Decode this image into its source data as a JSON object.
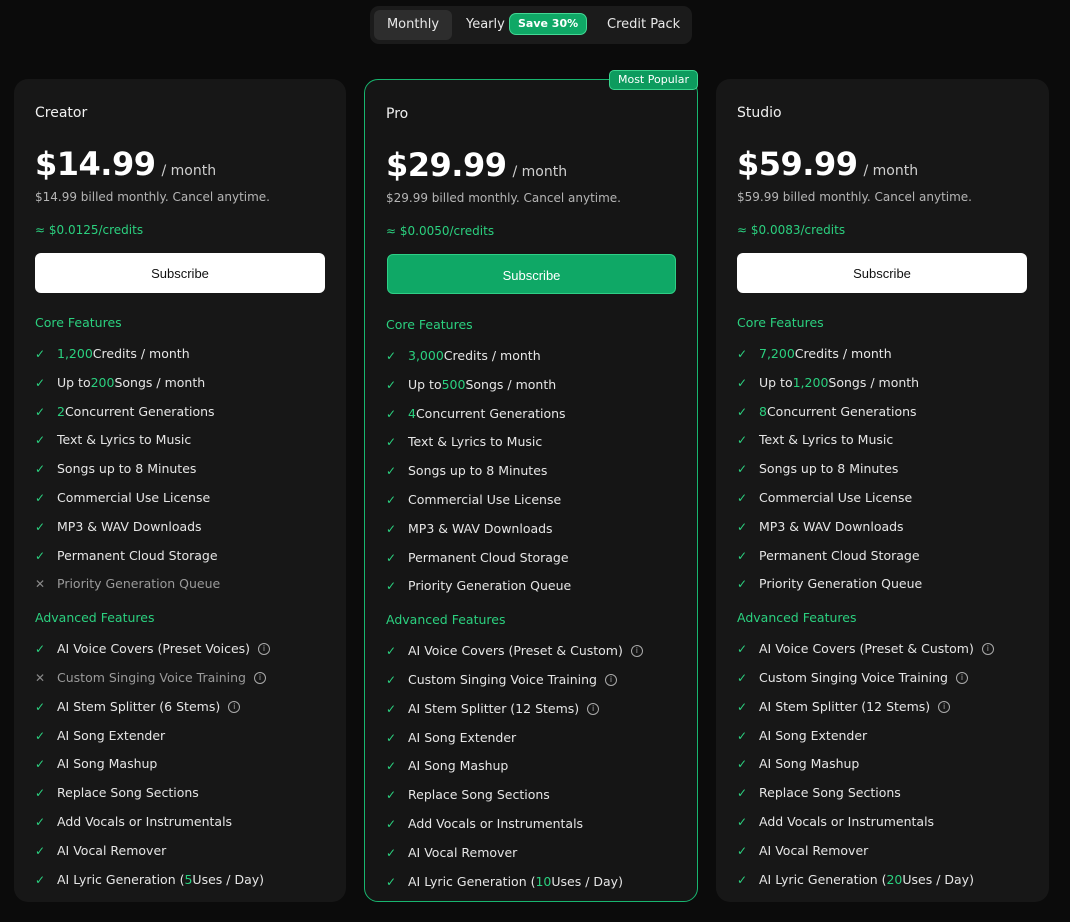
{
  "billing_toggle": {
    "monthly": "Monthly",
    "yearly": "Yearly",
    "save_badge": "Save 30%",
    "credit_pack": "Credit Pack"
  },
  "sections": {
    "core": "Core Features",
    "advanced": "Advanced Features"
  },
  "icons": {
    "included": "check-icon",
    "excluded": "x-icon",
    "info": "info-icon"
  },
  "colors": {
    "accent": "#2bd07f",
    "button_green": "#0fa866"
  },
  "plans": [
    {
      "name": "Creator",
      "price": "$14.99",
      "period": "/ month",
      "billed": "$14.99 billed monthly. Cancel anytime.",
      "credit_rate": "≈ $0.0125/credits",
      "subscribe_label": "Subscribe",
      "core": [
        {
          "included": true,
          "hl": "1,200",
          "text": " Credits / month"
        },
        {
          "included": true,
          "pre": "Up to ",
          "hl": "200",
          "text": " Songs / month"
        },
        {
          "included": true,
          "hl": "2",
          "text": " Concurrent Generations"
        },
        {
          "included": true,
          "text": "Text & Lyrics to Music"
        },
        {
          "included": true,
          "text": "Songs up to 8 Minutes"
        },
        {
          "included": true,
          "text": "Commercial Use License"
        },
        {
          "included": true,
          "text": "MP3 & WAV Downloads"
        },
        {
          "included": true,
          "text": "Permanent Cloud Storage"
        },
        {
          "included": false,
          "text": "Priority Generation Queue"
        }
      ],
      "advanced": [
        {
          "included": true,
          "text": "AI Voice Covers (Preset Voices)",
          "info": true
        },
        {
          "included": false,
          "text": "Custom Singing Voice Training",
          "info": true
        },
        {
          "included": true,
          "text": "AI Stem Splitter (6 Stems)",
          "info": true
        },
        {
          "included": true,
          "text": "AI Song Extender"
        },
        {
          "included": true,
          "text": "AI Song Mashup"
        },
        {
          "included": true,
          "text": "Replace Song Sections"
        },
        {
          "included": true,
          "text": "Add Vocals or Instrumentals"
        },
        {
          "included": true,
          "text": "AI Vocal Remover"
        },
        {
          "included": true,
          "pre": "AI Lyric Generation (",
          "hl": "5",
          "text": " Uses / Day)"
        }
      ]
    },
    {
      "name": "Pro",
      "badge": "Most Popular",
      "price": "$29.99",
      "period": "/ month",
      "billed": "$29.99 billed monthly. Cancel anytime.",
      "credit_rate": "≈ $0.0050/credits",
      "subscribe_label": "Subscribe",
      "core": [
        {
          "included": true,
          "hl": "3,000",
          "text": " Credits / month"
        },
        {
          "included": true,
          "pre": "Up to ",
          "hl": "500",
          "text": " Songs / month"
        },
        {
          "included": true,
          "hl": "4",
          "text": " Concurrent Generations"
        },
        {
          "included": true,
          "text": "Text & Lyrics to Music"
        },
        {
          "included": true,
          "text": "Songs up to 8 Minutes"
        },
        {
          "included": true,
          "text": "Commercial Use License"
        },
        {
          "included": true,
          "text": "MP3 & WAV Downloads"
        },
        {
          "included": true,
          "text": "Permanent Cloud Storage"
        },
        {
          "included": true,
          "text": "Priority Generation Queue"
        }
      ],
      "advanced": [
        {
          "included": true,
          "text": "AI Voice Covers (Preset & Custom)",
          "info": true
        },
        {
          "included": true,
          "text": "Custom Singing Voice Training",
          "info": true
        },
        {
          "included": true,
          "text": "AI Stem Splitter (12 Stems)",
          "info": true
        },
        {
          "included": true,
          "text": "AI Song Extender"
        },
        {
          "included": true,
          "text": "AI Song Mashup"
        },
        {
          "included": true,
          "text": "Replace Song Sections"
        },
        {
          "included": true,
          "text": "Add Vocals or Instrumentals"
        },
        {
          "included": true,
          "text": "AI Vocal Remover"
        },
        {
          "included": true,
          "pre": "AI Lyric Generation (",
          "hl": "10",
          "text": " Uses / Day)"
        }
      ]
    },
    {
      "name": "Studio",
      "price": "$59.99",
      "period": "/ month",
      "billed": "$59.99 billed monthly. Cancel anytime.",
      "credit_rate": "≈ $0.0083/credits",
      "subscribe_label": "Subscribe",
      "core": [
        {
          "included": true,
          "hl": "7,200",
          "text": " Credits / month"
        },
        {
          "included": true,
          "pre": "Up to ",
          "hl": "1,200",
          "text": " Songs / month"
        },
        {
          "included": true,
          "hl": "8",
          "text": " Concurrent Generations"
        },
        {
          "included": true,
          "text": "Text & Lyrics to Music"
        },
        {
          "included": true,
          "text": "Songs up to 8 Minutes"
        },
        {
          "included": true,
          "text": "Commercial Use License"
        },
        {
          "included": true,
          "text": "MP3 & WAV Downloads"
        },
        {
          "included": true,
          "text": "Permanent Cloud Storage"
        },
        {
          "included": true,
          "text": "Priority Generation Queue"
        }
      ],
      "advanced": [
        {
          "included": true,
          "text": "AI Voice Covers (Preset & Custom)",
          "info": true
        },
        {
          "included": true,
          "text": "Custom Singing Voice Training",
          "info": true
        },
        {
          "included": true,
          "text": "AI Stem Splitter (12 Stems)",
          "info": true
        },
        {
          "included": true,
          "text": "AI Song Extender"
        },
        {
          "included": true,
          "text": "AI Song Mashup"
        },
        {
          "included": true,
          "text": "Replace Song Sections"
        },
        {
          "included": true,
          "text": "Add Vocals or Instrumentals"
        },
        {
          "included": true,
          "text": "AI Vocal Remover"
        },
        {
          "included": true,
          "pre": "AI Lyric Generation (",
          "hl": "20",
          "text": " Uses / Day)"
        }
      ]
    }
  ]
}
